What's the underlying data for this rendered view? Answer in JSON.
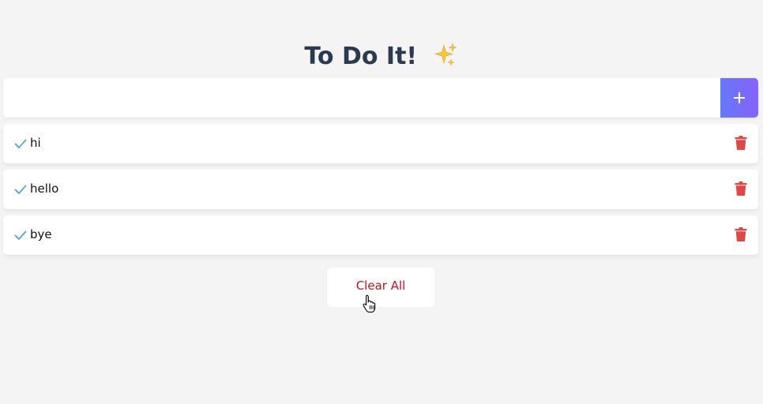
{
  "header": {
    "title": "To Do It!",
    "title_icon": "sparkles-icon"
  },
  "input": {
    "value": "",
    "placeholder": "",
    "add_icon": "plus-icon"
  },
  "todos": [
    {
      "text": "hi",
      "status_icon": "check-icon",
      "action_icon": "trash-icon"
    },
    {
      "text": "hello",
      "status_icon": "check-icon",
      "action_icon": "trash-icon"
    },
    {
      "text": "bye",
      "status_icon": "check-icon",
      "action_icon": "trash-icon"
    }
  ],
  "footer": {
    "clear_label": "Clear All"
  },
  "colors": {
    "background": "#f4f4f4",
    "title": "#2c3a50",
    "accent_gradient_start": "#6478fb",
    "accent_gradient_end": "#8763fb",
    "check": "#62a9d9",
    "trash": "#e04848",
    "clear_text": "#c0131e"
  }
}
